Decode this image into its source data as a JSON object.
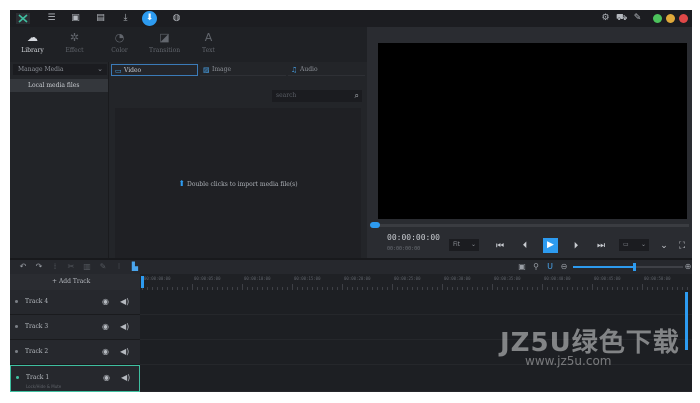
{
  "topbar": {
    "icons": [
      "list-icon",
      "save-icon",
      "save-as-icon",
      "download-icon",
      "export-icon",
      "globe-icon"
    ],
    "right_icons": [
      "gear-icon",
      "cart-icon",
      "tools-icon"
    ],
    "window_colors": [
      "#4cc35c",
      "#e0a93a",
      "#e04848"
    ]
  },
  "tabs": [
    {
      "label": "Library",
      "icon": "library-icon"
    },
    {
      "label": "Effect",
      "icon": "effect-icon"
    },
    {
      "label": "Color",
      "icon": "color-icon"
    },
    {
      "label": "Transition",
      "icon": "transition-icon"
    },
    {
      "label": "Text",
      "icon": "text-icon"
    }
  ],
  "library": {
    "manage_label": "Manage Media",
    "local_label": "Local media files",
    "media_tabs": [
      "Video",
      "Image",
      "Audio"
    ],
    "search_placeholder": "search",
    "import_hint": "Double clicks to import media file(s)"
  },
  "player": {
    "timecode": "00:00:00:00",
    "timecode_total": "00:00:00:00",
    "fit_label": "Fit"
  },
  "timeline": {
    "add_track_label": "Add Track",
    "ruler_labels": [
      "00:00:00:00",
      "00:00:05:00",
      "00:00:10:00",
      "00:00:15:00",
      "00:00:20:00",
      "00:00:25:00",
      "00:00:30:00",
      "00:00:35:00",
      "00:00:40:00",
      "00:00:45:00",
      "00:00:50:00"
    ],
    "tracks": [
      "Track 4",
      "Track 3",
      "Track 2",
      "Track 1"
    ],
    "track1_sub": "Lock/Hide & Mute",
    "zoom_level": 0.55
  },
  "watermark": {
    "line1": "JZ5U绿色下载",
    "line2": "www.jz5u.com"
  }
}
